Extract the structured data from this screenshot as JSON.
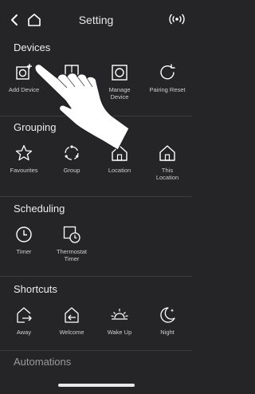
{
  "header": {
    "title": "Setting"
  },
  "sections": {
    "devices": {
      "heading": "Devices",
      "items": [
        {
          "label": "Add Device",
          "icon": "add-device-icon"
        },
        {
          "label": "",
          "icon": "device-list-icon"
        },
        {
          "label": "Manage\nDevice",
          "icon": "manage-device-icon"
        },
        {
          "label": "Pairing Reset",
          "icon": "pairing-reset-icon"
        }
      ]
    },
    "grouping": {
      "heading": "Grouping",
      "items": [
        {
          "label": "Favourites",
          "icon": "star-icon"
        },
        {
          "label": "Group",
          "icon": "group-icon"
        },
        {
          "label": "Location",
          "icon": "location-home-icon"
        },
        {
          "label": "This\nLocation",
          "icon": "this-location-home-icon"
        }
      ]
    },
    "scheduling": {
      "heading": "Scheduling",
      "items": [
        {
          "label": "Timer",
          "icon": "clock-icon"
        },
        {
          "label": "Thermostat\nTimer",
          "icon": "thermostat-timer-icon"
        }
      ]
    },
    "shortcuts": {
      "heading": "Shortcuts",
      "items": [
        {
          "label": "Away",
          "icon": "away-icon"
        },
        {
          "label": "Welcome",
          "icon": "welcome-icon"
        },
        {
          "label": "Wake Up",
          "icon": "sunrise-icon"
        },
        {
          "label": "Night",
          "icon": "moon-icon"
        }
      ]
    },
    "automations": {
      "heading": "Automations"
    }
  },
  "colors": {
    "background": "#252527",
    "text": "#ffffff",
    "muted": "#cfcfcf",
    "divider": "#3d3d40"
  }
}
